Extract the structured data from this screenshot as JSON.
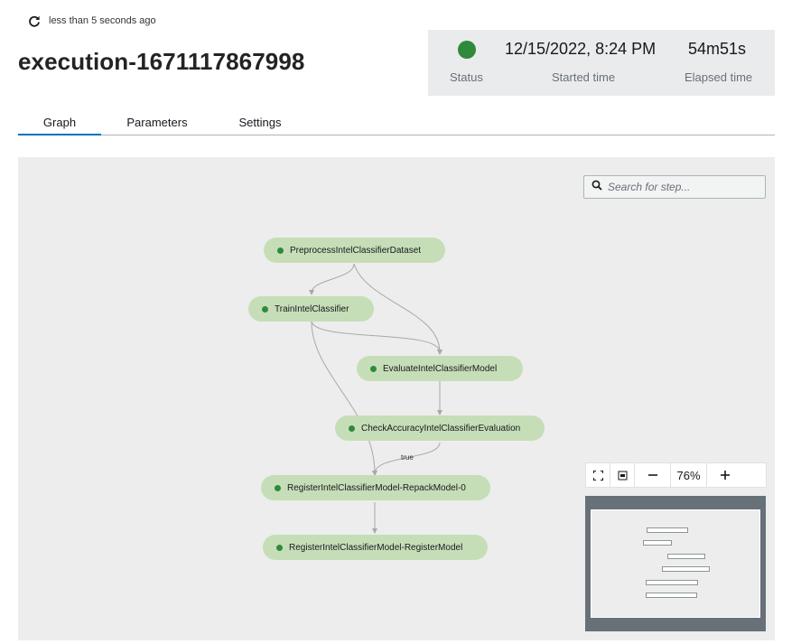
{
  "header": {
    "refresh_text": "less than 5 seconds ago",
    "title": "execution-1671117867998"
  },
  "stats": {
    "status_label": "Status",
    "status_color": "#2f8a3c",
    "started_value": "12/15/2022, 8:24 PM",
    "started_label": "Started time",
    "elapsed_value": "54m51s",
    "elapsed_label": "Elapsed time"
  },
  "tabs": [
    {
      "label": "Graph",
      "active": true
    },
    {
      "label": "Parameters",
      "active": false
    },
    {
      "label": "Settings",
      "active": false
    }
  ],
  "graph": {
    "search_placeholder": "Search for step...",
    "nodes": [
      {
        "label": "PreprocessIntelClassifierDataset"
      },
      {
        "label": "TrainIntelClassifier"
      },
      {
        "label": "EvaluateIntelClassifierModel"
      },
      {
        "label": "CheckAccuracyIntelClassifierEvaluation"
      },
      {
        "label": "RegisterIntelClassifierModel-RepackModel-0"
      },
      {
        "label": "RegisterIntelClassifierModel-RegisterModel"
      }
    ],
    "edge_label": "true",
    "node_status_color": "#2f8a3c",
    "node_color": "#c6deb7"
  },
  "zoom": {
    "level": "76%",
    "fit_icon": "fit-screen-icon",
    "center_icon": "center-icon",
    "zoom_out_icon": "minus-icon",
    "zoom_in_icon": "plus-icon"
  }
}
